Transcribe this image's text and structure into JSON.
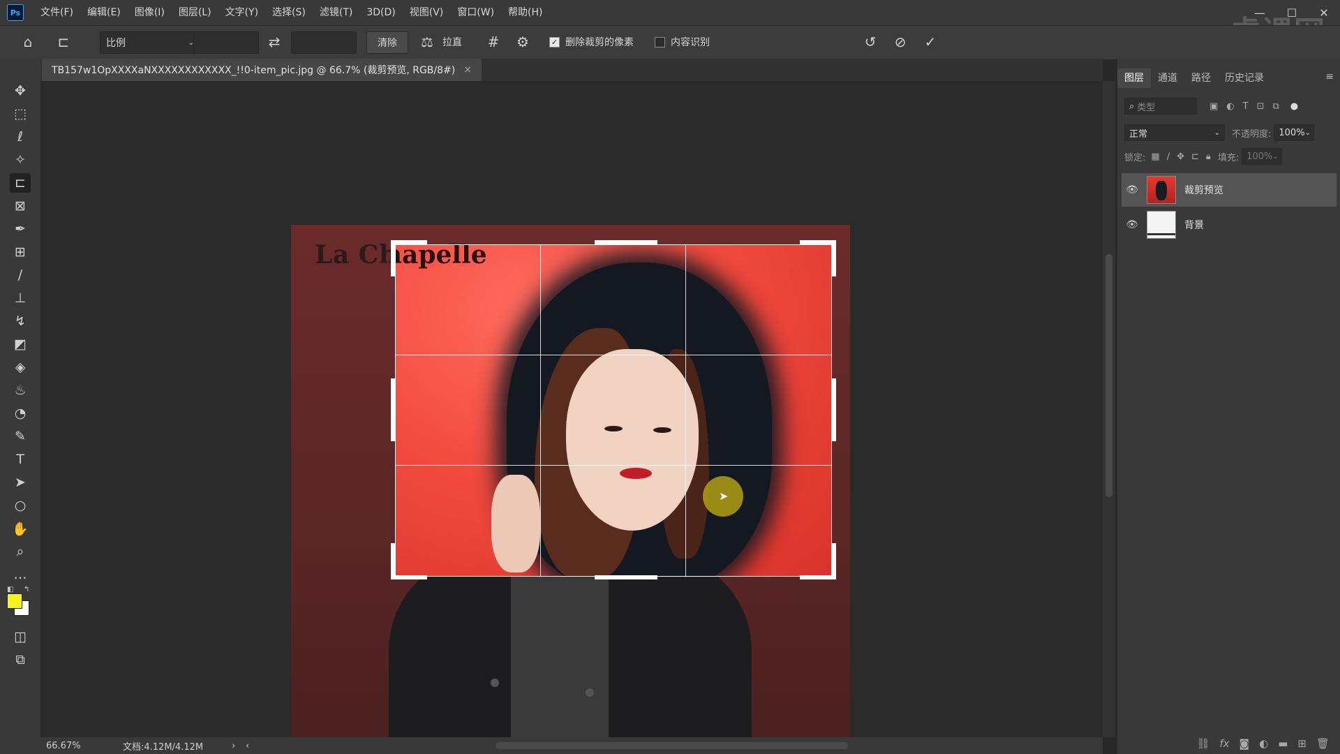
{
  "app": {
    "logo": "Ps",
    "menu": [
      "文件(F)",
      "编辑(E)",
      "图像(I)",
      "图层(L)",
      "文字(Y)",
      "选择(S)",
      "滤镜(T)",
      "3D(D)",
      "视图(V)",
      "窗口(W)",
      "帮助(H)"
    ],
    "window_controls": [
      "—",
      "☐",
      "✕"
    ],
    "watermark": "虎课网"
  },
  "options_bar": {
    "ratio_dropdown": "比例",
    "ratio_width": "",
    "ratio_height": "",
    "clear_label": "清除",
    "straighten_label": "拉直",
    "delete_cropped_label": "删除裁剪的像素",
    "delete_cropped_checked": true,
    "content_aware_label": "内容识别",
    "content_aware_checked": false
  },
  "document": {
    "tab_title": "TB157w1OpXXXXaNXXXXXXXXXXXX_!!0-item_pic.jpg @ 66.7% (裁剪预览, RGB/8#)",
    "brand_text": "La Chapelle"
  },
  "status_bar": {
    "zoom": "66.67%",
    "doc_size": "文档:4.12M/4.12M"
  },
  "layers_panel": {
    "tabs": [
      "图层",
      "通道",
      "路径",
      "历史记录"
    ],
    "active_tab": "图层",
    "filter_placeholder": "类型",
    "blend_mode": "正常",
    "opacity_label": "不透明度:",
    "opacity_value": "100%",
    "lock_label": "锁定:",
    "fill_label": "填充:",
    "fill_value": "100%",
    "layers": [
      {
        "name": "裁剪预览",
        "selected": true
      },
      {
        "name": "背景",
        "selected": false
      }
    ]
  },
  "colors": {
    "foreground": "#f5f51e",
    "background": "#ffffff"
  }
}
